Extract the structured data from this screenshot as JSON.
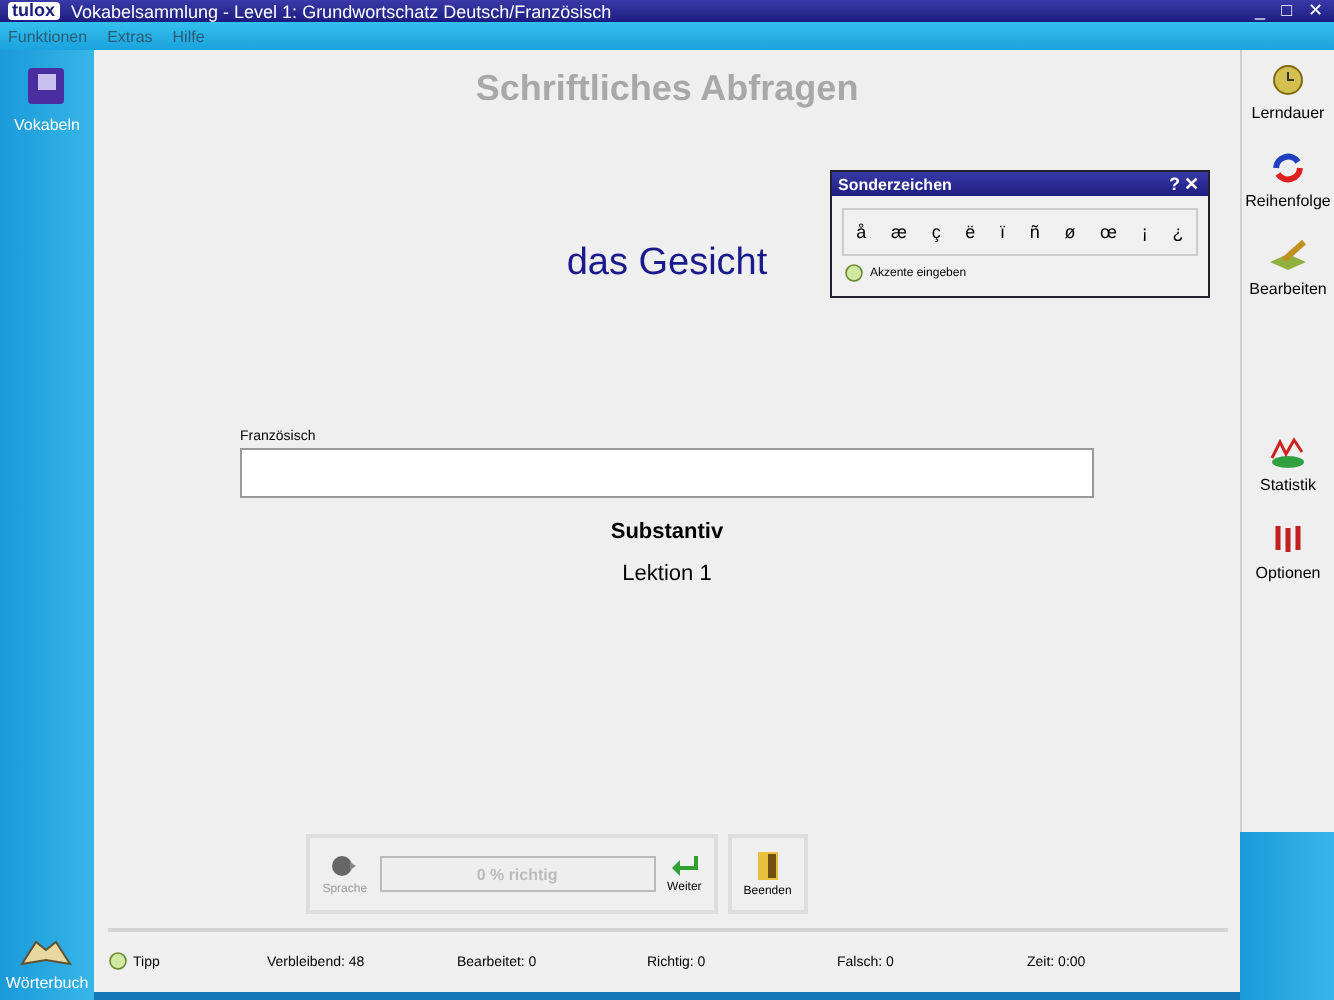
{
  "window": {
    "logo": "tulox",
    "title": "Vokabelsammlung - Level 1: Grundwortschatz Deutsch/Französisch",
    "controls": [
      "_",
      "□",
      "✕"
    ]
  },
  "menu": [
    "Funktionen",
    "Extras",
    "Hilfe"
  ],
  "left_sidebar": [
    {
      "label": "Vokabeln"
    }
  ],
  "dictionary": {
    "label": "Wörterbuch"
  },
  "heading": "Schriftliches Abfragen",
  "word": "das Gesicht",
  "answer": {
    "label": "Französisch"
  },
  "word_type": "Substantiv",
  "lesson": "Lektion 1",
  "toolbar": {
    "speech": {
      "label": "Sprache",
      "disabled": true
    },
    "progress": {
      "text": "0 % richtig",
      "level": 0
    },
    "next": {
      "label": "Weiter"
    },
    "finish": {
      "label": "Beenden"
    }
  },
  "right_sidebar": [
    {
      "label": "Lerndauer"
    },
    {
      "label": "Reihenfolge"
    },
    {
      "label": "Bearbeiten"
    },
    {
      "label": "Statistik"
    },
    {
      "label": "Optionen"
    }
  ],
  "special_chars": {
    "title": "Sonderzeichen",
    "help": "?",
    "close": "✕",
    "chars": [
      "å",
      "æ",
      "ç",
      "ë",
      "ï",
      "ñ",
      "ø",
      "œ",
      "¡",
      "¿"
    ],
    "hint": "Akzente eingeben"
  },
  "status": {
    "tip": "Tipp",
    "items": [
      "Verbleibend: 48",
      "Bearbeitet: 0",
      "Richtig: 0",
      "Falsch: 0",
      "Zeit: 0:00"
    ]
  }
}
